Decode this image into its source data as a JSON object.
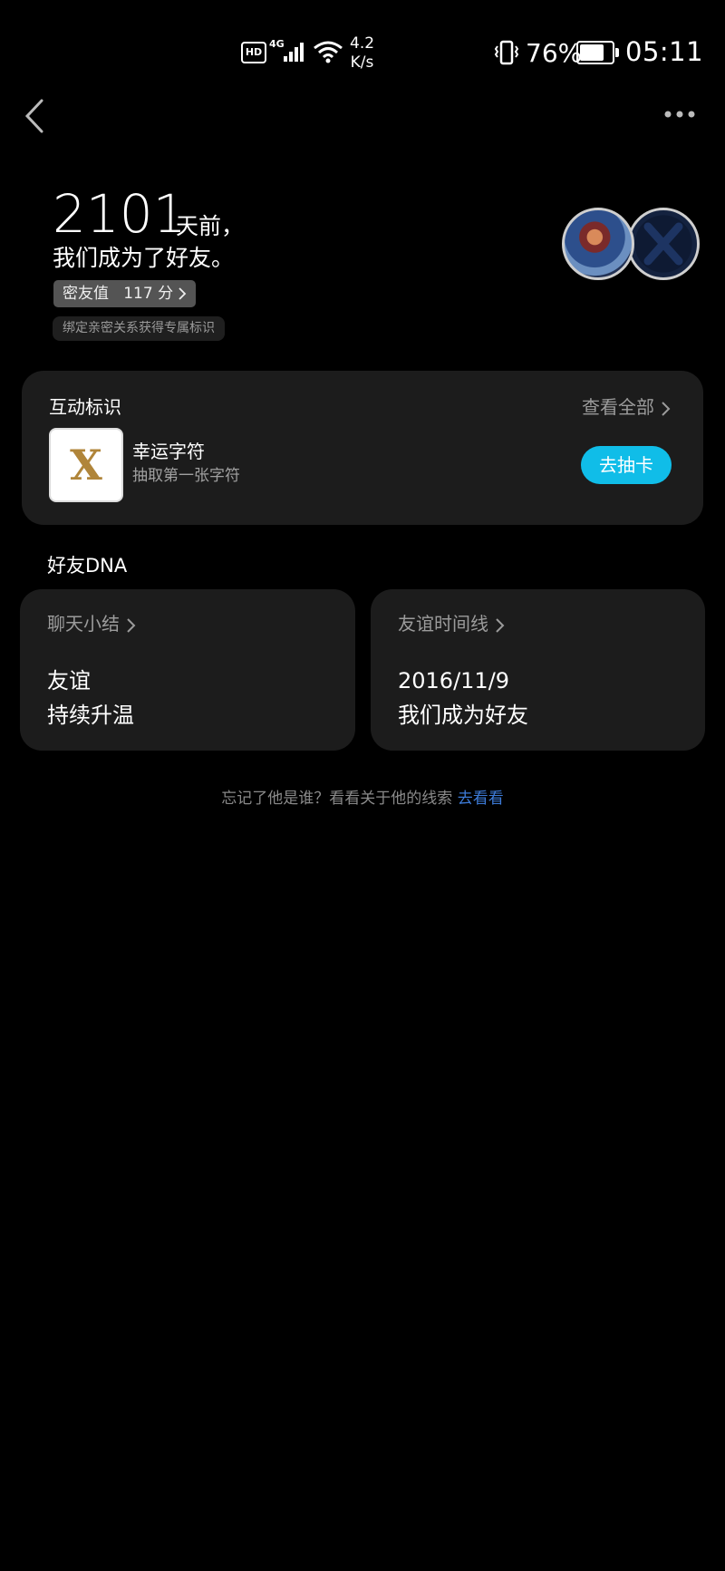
{
  "status_bar": {
    "hd": "HD",
    "network": "4G",
    "speed_value": "4.2",
    "speed_unit": "K/s",
    "battery_pct": "76%",
    "battery_level": 0.76,
    "time": "05:11"
  },
  "header": {
    "back_icon": "chevron-left-icon",
    "more_icon": "more-icon"
  },
  "friendship": {
    "days": "2101",
    "days_suffix": "天前，",
    "line2": "我们成为了好友。",
    "score_label": "密友值",
    "score_value": "117 分",
    "bind_hint": "绑定亲密关系获得专属标识"
  },
  "interaction": {
    "title": "互动标识",
    "view_all": "查看全部",
    "badge_letter": "X",
    "badge_name": "幸运字符",
    "badge_desc": "抽取第一张字符",
    "draw_button": "去抽卡",
    "accent": "#10bde8"
  },
  "dna": {
    "title": "好友DNA",
    "chat_summary": {
      "heading": "聊天小结",
      "line1": "友谊",
      "line2": "持续升温"
    },
    "timeline": {
      "heading": "友谊时间线",
      "line1": "2016/11/9",
      "line2": "我们成为好友"
    }
  },
  "footer": {
    "text": "忘记了他是谁？看看关于他的线索",
    "link": "去看看",
    "link_color": "#3d7bd8"
  }
}
